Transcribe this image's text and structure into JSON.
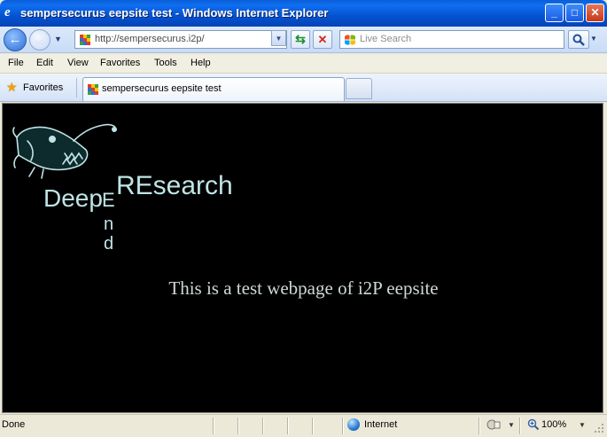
{
  "window": {
    "title": "sempersecurus eepsite test - Windows Internet Explorer",
    "minimize_glyph": "_",
    "maximize_glyph": "□",
    "close_glyph": "✕"
  },
  "navigation": {
    "back_glyph": "←",
    "forward_glyph": "→",
    "address": "http://sempersecurus.i2p/",
    "search_placeholder": "Live Search"
  },
  "menu": {
    "items": [
      "File",
      "Edit",
      "View",
      "Favorites",
      "Tools",
      "Help"
    ]
  },
  "favorites_bar": {
    "label": "Favorites"
  },
  "tabs": [
    {
      "label": "sempersecurus eepsite test",
      "active": true
    }
  ],
  "page": {
    "logo": {
      "word_deep": "Deep",
      "word_research": "REsearch",
      "word_end": "End"
    },
    "body_text": "This is a test webpage of i2P eepsite",
    "background_color": "#000000",
    "text_color": "#cfd8d8"
  },
  "status_bar": {
    "status": "Done",
    "zone": "Internet",
    "zoom": "100%"
  },
  "icons": {
    "ie_logo": "ie-logo-icon",
    "back": "back-arrow-icon",
    "forward": "forward-arrow-icon",
    "refresh": "refresh-icon",
    "stop": "stop-icon",
    "search": "magnifier-icon",
    "favorites": "star-icon",
    "globe": "globe-icon",
    "zoom": "zoom-icon"
  },
  "colors": {
    "titlebar": "#0553d0",
    "chrome": "#ece9d8"
  }
}
